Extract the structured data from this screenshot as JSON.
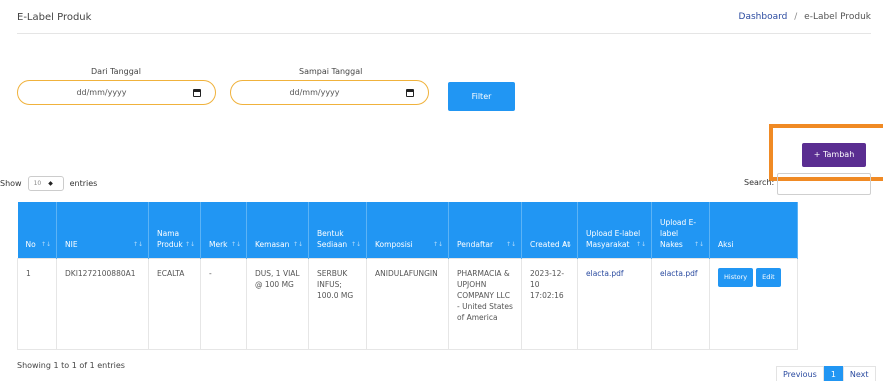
{
  "header": {
    "title": "E-Label Produk",
    "breadcrumb": {
      "home": "Dashboard",
      "separator": "/",
      "current": "e-Label Produk"
    }
  },
  "filters": {
    "from_label": "Dari Tanggal",
    "from_placeholder": "dd/mm/yyyy",
    "to_label": "Sampai Tanggal",
    "to_placeholder": "dd/mm/yyyy",
    "filter_button": "Filter"
  },
  "actions": {
    "add_button": "+ Tambah"
  },
  "table_controls": {
    "show_label": "Show",
    "page_length": "10",
    "entries_label": "entries",
    "search_label": "Search:"
  },
  "table": {
    "columns": [
      "No",
      "NIE",
      "Nama Produk",
      "Merk",
      "Kemasan",
      "Bentuk Sediaan",
      "Komposisi",
      "Pendaftar",
      "Created At",
      "Upload E-label Masyarakat",
      "Upload E-label Nakes",
      "Aksi"
    ],
    "rows": [
      {
        "no": "1",
        "nie": "DKI1272100880A1",
        "nama_produk": "ECALTA",
        "merk": "-",
        "kemasan": "DUS, 1 VIAL @ 100 MG",
        "bentuk_sediaan": "SERBUK INFUS; 100.0 MG",
        "komposisi": "ANIDULAFUNGIN",
        "pendaftar": "PHARMACIA & UPJOHN COMPANY LLC - United States of America",
        "created_at": "2023-12-10 17:02:16",
        "elabel_masyarakat": "elacta.pdf",
        "elabel_nakes": "elacta.pdf",
        "history_button": "History",
        "edit_button": "Edit"
      }
    ]
  },
  "footer": {
    "info": "Showing 1 to 1 of 1 entries",
    "prev": "Previous",
    "page": "1",
    "next": "Next"
  },
  "colors": {
    "primary": "#2196f3",
    "add_button": "#5a2d91",
    "highlight": "#f08a24",
    "date_border": "#f0b23c",
    "link": "#2b4ba0"
  }
}
